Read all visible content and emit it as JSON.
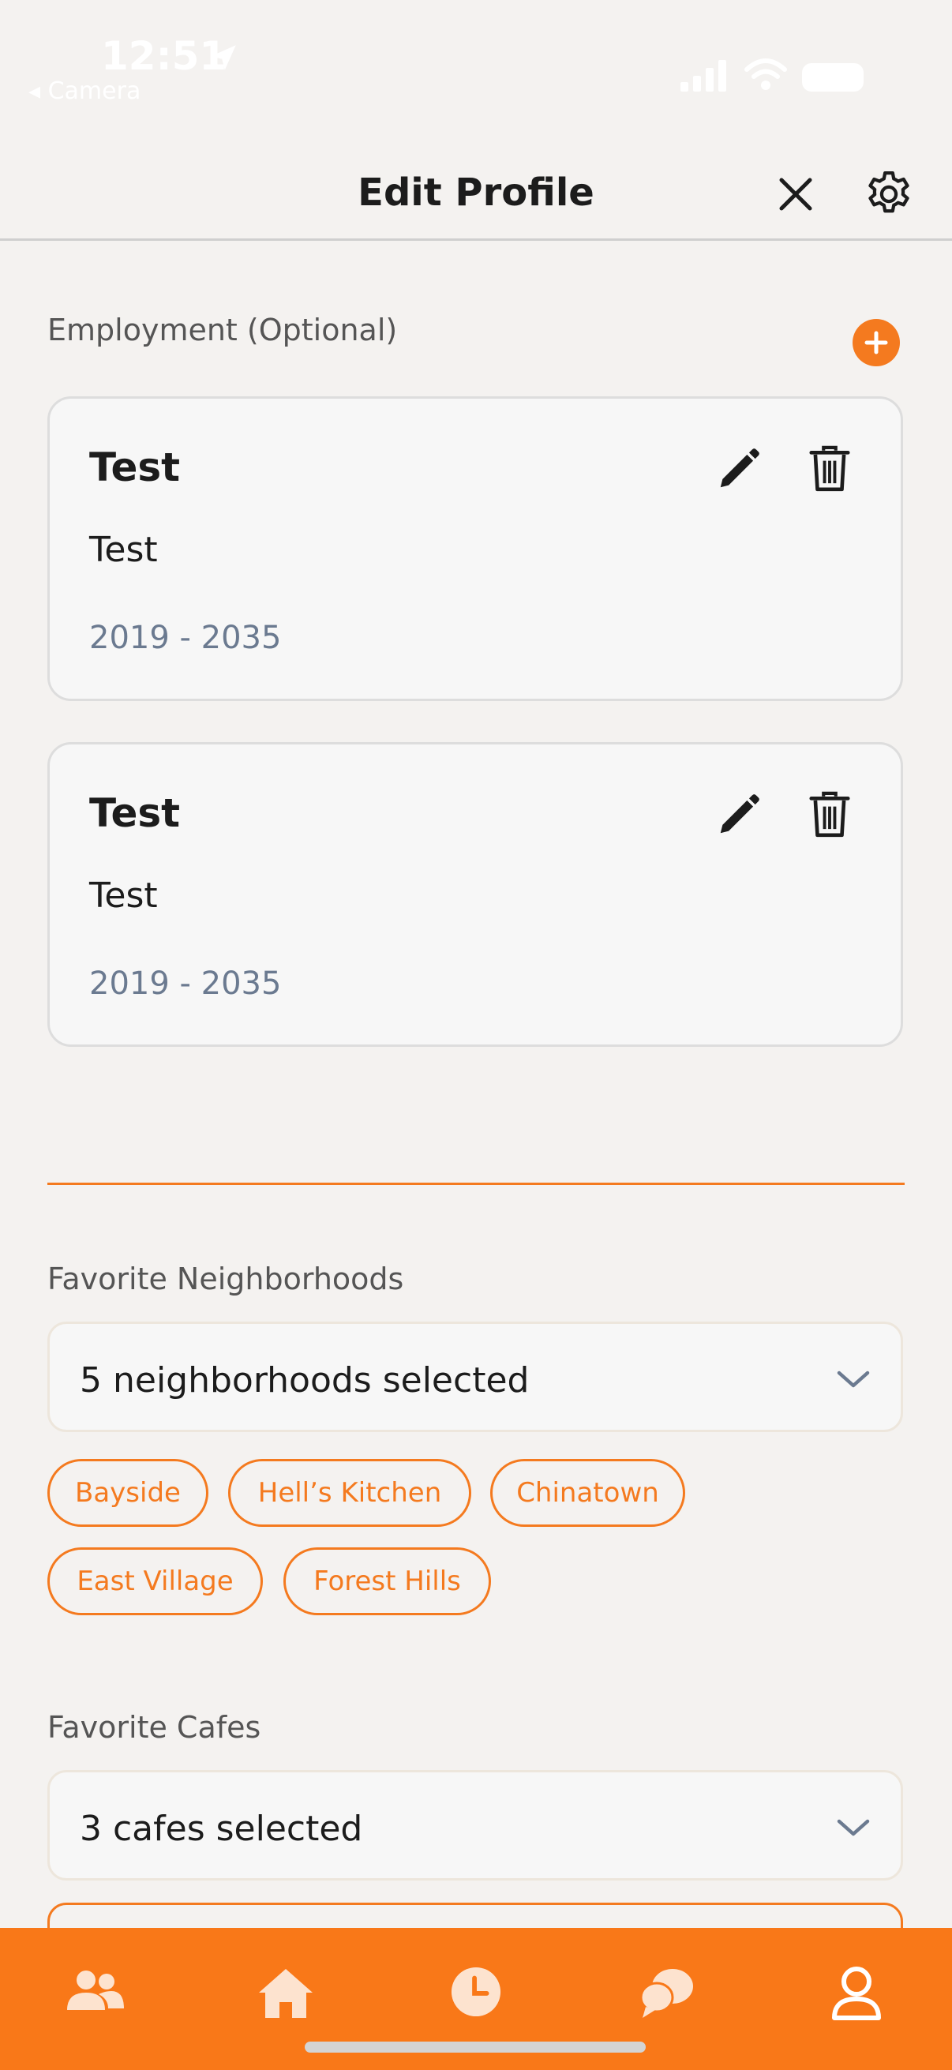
{
  "status_bar": {
    "time": "12:51",
    "back_app": "◂ Camera"
  },
  "header": {
    "title": "Edit Profile"
  },
  "employment": {
    "label": "Employment (Optional)",
    "items": [
      {
        "title": "Test",
        "subtitle": "Test",
        "dates": "2019 - 2035"
      },
      {
        "title": "Test",
        "subtitle": "Test",
        "dates": "2019 - 2035"
      }
    ]
  },
  "neighborhoods": {
    "label": "Favorite Neighborhoods",
    "selected_text": "5 neighborhoods selected",
    "chips": [
      "Bayside",
      "Hell’s Kitchen",
      "Chinatown",
      "East Village",
      "Forest Hills"
    ]
  },
  "cafes": {
    "label": "Favorite Cafes",
    "selected_text": "3 cafes selected"
  },
  "tab_bar": {
    "tabs": [
      "people-icon",
      "home-icon",
      "clock-icon",
      "chat-icon",
      "profile-icon"
    ]
  },
  "colors": {
    "accent": "#f47a1f",
    "background": "#f4f2f0",
    "card": "#f7f7f7",
    "muted_text": "#6b7a90"
  }
}
